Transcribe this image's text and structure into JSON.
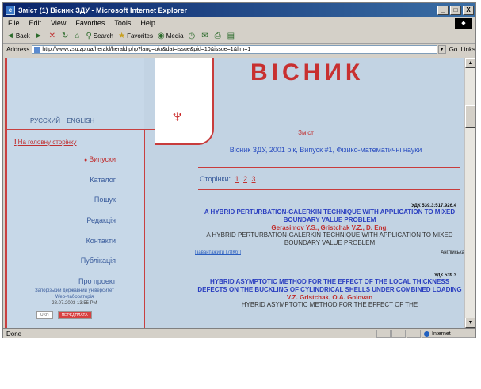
{
  "window": {
    "title": "Зміст (1) Вісник ЗДУ - Microsoft Internet Explorer",
    "min": "_",
    "max": "□",
    "close": "X"
  },
  "menu": [
    "File",
    "Edit",
    "View",
    "Favorites",
    "Tools",
    "Help"
  ],
  "toolbar": [
    "Back",
    "Search",
    "Favorites",
    "Media"
  ],
  "address": {
    "label": "Address",
    "url": "http://www.zsu.zp.ua/herald/herald.php?lang=ukr&dat=issue&pid=10&issue=1&lim=1",
    "go": "Go",
    "links": "Links"
  },
  "page": {
    "masthead": "ВІСНИК",
    "langs": [
      "РУССКИЙ",
      "ENGLISH"
    ],
    "home": "На головну сторінку",
    "nav": [
      "Випуски",
      "Каталог",
      "Пошук",
      "Редакція",
      "Контакти",
      "Публікація",
      "Про проект"
    ],
    "footer_org": "Запорізький державний університет",
    "footer_lab": "Web-лабораторія",
    "footer_date": "28.07.2003 13:55 PM",
    "btn_ukr": "UKR",
    "btn_other": "ПЕРЕДПЛАТА",
    "zmist": "Зміст",
    "issue_title": "Вісник ЗДУ, 2001 рік, Випуск #1, Фізико-математичні науки",
    "pages_label": "Сторінки:",
    "pages": [
      "1",
      "2",
      "3"
    ],
    "articles": [
      {
        "udk": "УДК 539.3:517.926.4",
        "title": "A HYBRID PERTURBATION-GALERKIN TECHNIQUE WITH APPLICATION TO MIXED BOUNDARY VALUE PROBLEM",
        "authors": "Gerasimov Y.S., Gristchak V.Z., D. Eng.",
        "title2": "A HYBRID PERTURBATION-GALERKIN TECHNIQUE WITH APPLICATION TO MIXED BOUNDARY VALUE PROBLEM",
        "link": "[завантажити (78Кб)]",
        "lang": "Англійська"
      },
      {
        "udk": "УДК 539.3",
        "title": "HYBRID ASYMPTOTIC METHOD FOR THE EFFECT OF THE LOCAL THICKNESS DEFECTS ON THE BUCKLING OF CYLINDRICAL SHELLS UNDER COMBINED LOADING",
        "authors": "V.Z. Gristchak, O.A. Golovan",
        "title2": "HYBRID ASYMPTOTIC METHOD FOR THE EFFECT OF THE"
      }
    ]
  },
  "status": {
    "text": "Done",
    "zone": "Internet"
  }
}
